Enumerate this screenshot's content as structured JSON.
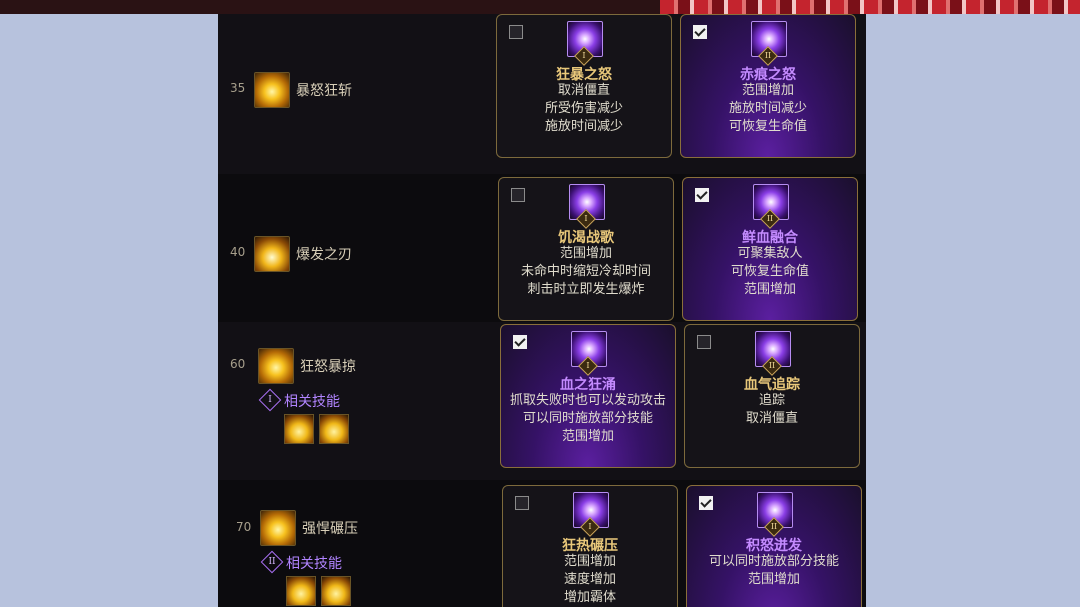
{
  "rows": [
    {
      "level": "35",
      "skill": "暴怒狂斩",
      "related": "",
      "left": {
        "title": "狂暴之怒",
        "badge": "I",
        "checked": false,
        "effects": [
          "取消僵直",
          "所受伤害减少",
          "施放时间减少"
        ]
      },
      "right": {
        "title": "赤痕之怒",
        "badge": "II",
        "checked": true,
        "effects": [
          "范围增加",
          "施放时间减少",
          "可恢复生命值"
        ]
      }
    },
    {
      "level": "40",
      "skill": "爆发之刃",
      "related": "",
      "left": {
        "title": "饥渴战歌",
        "badge": "I",
        "checked": false,
        "effects": [
          "范围增加",
          "未命中时缩短冷却时间",
          "刺击时立即发生爆炸"
        ]
      },
      "right": {
        "title": "鲜血融合",
        "badge": "II",
        "checked": true,
        "effects": [
          "可聚集敌人",
          "可恢复生命值",
          "范围增加"
        ]
      }
    },
    {
      "level": "60",
      "skill": "狂怒暴掠",
      "related": "相关技能",
      "related_badge": "I",
      "left": {
        "title": "血之狂涌",
        "badge": "I",
        "checked": true,
        "effects": [
          "抓取失败时也可以发动攻击",
          "可以同时施放部分技能",
          "范围增加"
        ]
      },
      "right": {
        "title": "血气追踪",
        "badge": "II",
        "checked": false,
        "effects": [
          "追踪",
          "取消僵直"
        ]
      }
    },
    {
      "level": "70",
      "skill": "强悍碾压",
      "related": "相关技能",
      "related_badge": "II",
      "left": {
        "title": "狂热碾压",
        "badge": "I",
        "checked": false,
        "effects": [
          "范围增加",
          "速度增加",
          "增加霸体"
        ]
      },
      "right": {
        "title": "积怒迸发",
        "badge": "II",
        "checked": true,
        "effects": [
          "可以同时施放部分技能",
          "范围增加"
        ]
      }
    }
  ]
}
